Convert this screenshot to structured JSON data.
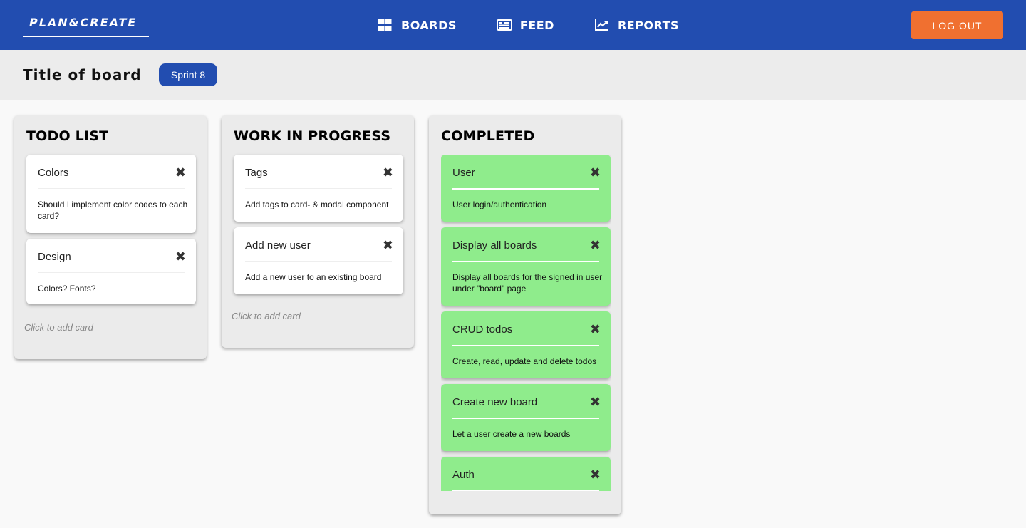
{
  "header": {
    "logo": "PLAN&CREATE",
    "nav": [
      {
        "label": "BOARDS",
        "icon": "grid-icon"
      },
      {
        "label": "FEED",
        "icon": "newspaper-icon"
      },
      {
        "label": "REPORTS",
        "icon": "chart-line-icon"
      }
    ],
    "logout_label": "LOG OUT",
    "colors": {
      "navbar": "#224db0",
      "logout": "#f07030"
    }
  },
  "board": {
    "title": "Title of board",
    "sprint_label": "Sprint 8"
  },
  "lists": [
    {
      "title": "TODO LIST",
      "add_card_label": "Click to add card",
      "cards": [
        {
          "title": "Colors",
          "description": "Should I implement color codes to each card?"
        },
        {
          "title": "Design",
          "description": "Colors? Fonts?"
        }
      ]
    },
    {
      "title": "WORK IN PROGRESS",
      "add_card_label": "Click to add card",
      "cards": [
        {
          "title": "Tags",
          "description": "Add tags to card- & modal component"
        },
        {
          "title": "Add new user",
          "description": "Add a new user to an existing board"
        }
      ]
    },
    {
      "title": "COMPLETED",
      "card_color": "#8fec8c",
      "cards": [
        {
          "title": "User",
          "description": "User login/authentication"
        },
        {
          "title": "Display all boards",
          "description": "Display all boards for the signed in user under \"board\" page"
        },
        {
          "title": "CRUD todos",
          "description": "Create, read, update and delete todos"
        },
        {
          "title": "Create new board",
          "description": "Let a user create a new boards"
        },
        {
          "title": "Auth",
          "description": ""
        }
      ]
    }
  ],
  "close_glyph": "✖"
}
